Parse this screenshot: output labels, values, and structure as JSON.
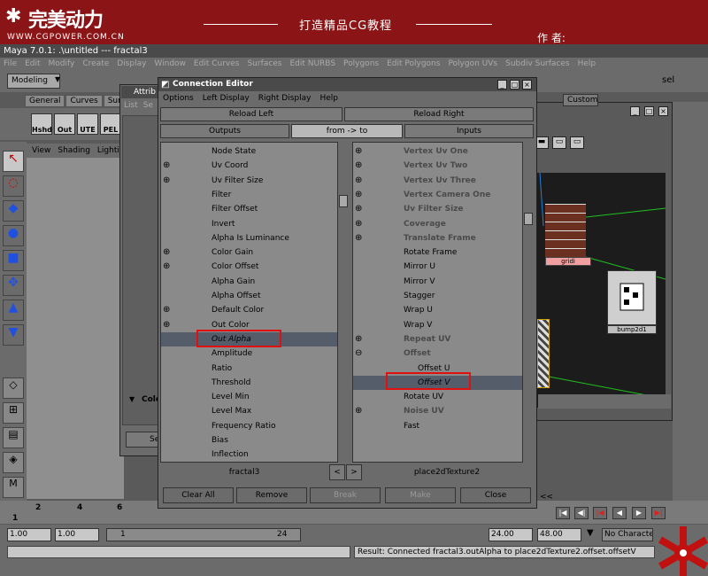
{
  "banner": {
    "logo": "完美动力",
    "url": "WWW.CGPOWER.COM.CN",
    "slogan": "打造精品CG教程",
    "author": "作 者:"
  },
  "maya": {
    "title": "Maya 7.0.1: .\\untitled   ---  fractal3",
    "menu": [
      "File",
      "Edit",
      "Modify",
      "Create",
      "Display",
      "Window",
      "Edit Curves",
      "Surfaces",
      "Edit NURBS",
      "Polygons",
      "Edit Polygons",
      "Polygon UVs",
      "Subdiv Surfaces",
      "Help"
    ],
    "mode": "Modeling",
    "shelf_tabs": [
      "General",
      "Curves",
      "Surfac"
    ],
    "shelf_buttons": [
      "Hshd",
      "Out",
      "UTE",
      "PEL"
    ],
    "viewport_menu": [
      "View",
      "Shading",
      "Lighting"
    ],
    "attr_title": "Attrib",
    "attr_tabs": [
      "List",
      "Se"
    ],
    "attr_node": "fractal3",
    "attr_col": "Colo",
    "attr_btn": "Se",
    "hyper_tab": "Custom",
    "sel_label": "sel",
    "brick_label": "gridi",
    "bump_label": "bump2d1"
  },
  "connection_editor": {
    "title": "Connection Editor",
    "menu": [
      "Options",
      "Left Display",
      "Right Display",
      "Help"
    ],
    "reload_left": "Reload Left",
    "reload_right": "Reload Right",
    "outputs": "Outputs",
    "direction": "from -> to",
    "inputs": "Inputs",
    "left_list": [
      {
        "label": "Node State",
        "exp": ""
      },
      {
        "label": "Uv Coord",
        "exp": "⊕"
      },
      {
        "label": "Uv Filter Size",
        "exp": "⊕"
      },
      {
        "label": "Filter",
        "exp": ""
      },
      {
        "label": "Filter Offset",
        "exp": ""
      },
      {
        "label": "Invert",
        "exp": ""
      },
      {
        "label": "Alpha Is Luminance",
        "exp": ""
      },
      {
        "label": "Color Gain",
        "exp": "⊕"
      },
      {
        "label": "Color Offset",
        "exp": "⊕"
      },
      {
        "label": "Alpha Gain",
        "exp": ""
      },
      {
        "label": "Alpha Offset",
        "exp": ""
      },
      {
        "label": "Default Color",
        "exp": "⊕"
      },
      {
        "label": "Out Color",
        "exp": "⊕"
      },
      {
        "label": "Out Alpha",
        "exp": "",
        "selected": true
      },
      {
        "label": "Amplitude",
        "exp": ""
      },
      {
        "label": "Ratio",
        "exp": ""
      },
      {
        "label": "Threshold",
        "exp": ""
      },
      {
        "label": "Level Min",
        "exp": ""
      },
      {
        "label": "Level Max",
        "exp": ""
      },
      {
        "label": "Frequency Ratio",
        "exp": ""
      },
      {
        "label": "Bias",
        "exp": ""
      },
      {
        "label": "Inflection",
        "exp": ""
      }
    ],
    "right_list": [
      {
        "label": "Vertex Uv One",
        "exp": "⊕",
        "bold": true
      },
      {
        "label": "Vertex Uv Two",
        "exp": "⊕",
        "bold": true
      },
      {
        "label": "Vertex Uv Three",
        "exp": "⊕",
        "bold": true
      },
      {
        "label": "Vertex Camera One",
        "exp": "⊕",
        "bold": true
      },
      {
        "label": "Uv Filter Size",
        "exp": "⊕",
        "bold": true
      },
      {
        "label": "Coverage",
        "exp": "⊕",
        "bold": true
      },
      {
        "label": "Translate Frame",
        "exp": "⊕",
        "bold": true
      },
      {
        "label": "Rotate Frame",
        "exp": ""
      },
      {
        "label": "Mirror U",
        "exp": ""
      },
      {
        "label": "Mirror V",
        "exp": ""
      },
      {
        "label": "Stagger",
        "exp": ""
      },
      {
        "label": "Wrap U",
        "exp": ""
      },
      {
        "label": "Wrap V",
        "exp": ""
      },
      {
        "label": "Repeat UV",
        "exp": "⊕",
        "bold": true
      },
      {
        "label": "Offset",
        "exp": "⊖",
        "bold": true
      },
      {
        "label": "Offset U",
        "exp": "",
        "indent": true
      },
      {
        "label": "Offset V",
        "exp": "",
        "indent": true,
        "selected": true
      },
      {
        "label": "Rotate UV",
        "exp": ""
      },
      {
        "label": "Noise UV",
        "exp": "⊕",
        "bold": true
      },
      {
        "label": "Fast",
        "exp": ""
      }
    ],
    "left_node": "fractal3",
    "right_node": "place2dTexture2",
    "nav_left": "<",
    "nav_right": ">",
    "buttons": {
      "clear_all": "Clear All",
      "remove": "Remove",
      "break": "Break",
      "make": "Make",
      "close": "Close"
    }
  },
  "timeline": {
    "ticks": [
      "1",
      "2",
      "4",
      "6"
    ],
    "start": "1.00",
    "start2": "1.00",
    "current": "1",
    "end_field": "24",
    "range_end": "24.00",
    "range_end2": "48.00",
    "char_set": "No Character Se",
    "scroll_marks": "<<"
  },
  "result": "Result: Connected fractal3.outAlpha to place2dTexture2.offset.offsetV"
}
